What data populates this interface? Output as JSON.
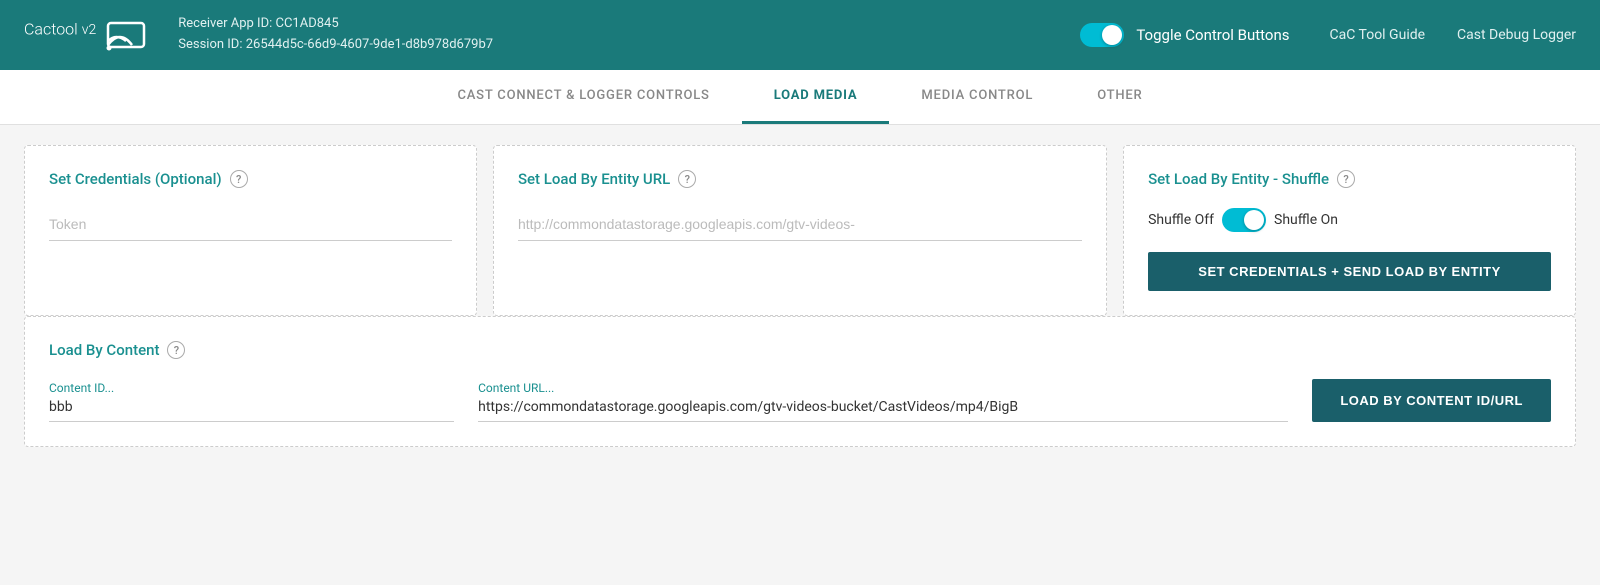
{
  "header": {
    "logo_text": "Cactool",
    "logo_version": "v2",
    "receiver_app_id_label": "Receiver App ID: CC1AD845",
    "session_id_label": "Session ID: 26544d5c-66d9-4607-9de1-d8b978d679b7",
    "toggle_label": "Toggle Control Buttons",
    "nav_guide": "CaC Tool Guide",
    "nav_logger": "Cast Debug Logger"
  },
  "tabs": [
    {
      "id": "cast-connect",
      "label": "CAST CONNECT & LOGGER CONTROLS",
      "active": false
    },
    {
      "id": "load-media",
      "label": "LOAD MEDIA",
      "active": true
    },
    {
      "id": "media-control",
      "label": "MEDIA CONTROL",
      "active": false
    },
    {
      "id": "other",
      "label": "OTHER",
      "active": false
    }
  ],
  "load_media": {
    "credentials": {
      "title": "Set Credentials (Optional)",
      "token_placeholder": "Token"
    },
    "entity_url": {
      "title": "Set Load By Entity URL",
      "url_placeholder": "http://commondatastorage.googleapis.com/gtv-videos-"
    },
    "shuffle": {
      "title": "Set Load By Entity - Shuffle",
      "shuffle_off_label": "Shuffle Off",
      "shuffle_on_label": "Shuffle On",
      "button_label": "SET CREDENTIALS + SEND LOAD BY ENTITY"
    },
    "load_by_content": {
      "title": "Load By Content",
      "content_id_label": "Content ID...",
      "content_id_value": "bbb",
      "content_url_label": "Content URL...",
      "content_url_value": "https://commondatastorage.googleapis.com/gtv-videos-bucket/CastVideos/mp4/BigB",
      "button_label": "LOAD BY CONTENT ID/URL"
    }
  }
}
